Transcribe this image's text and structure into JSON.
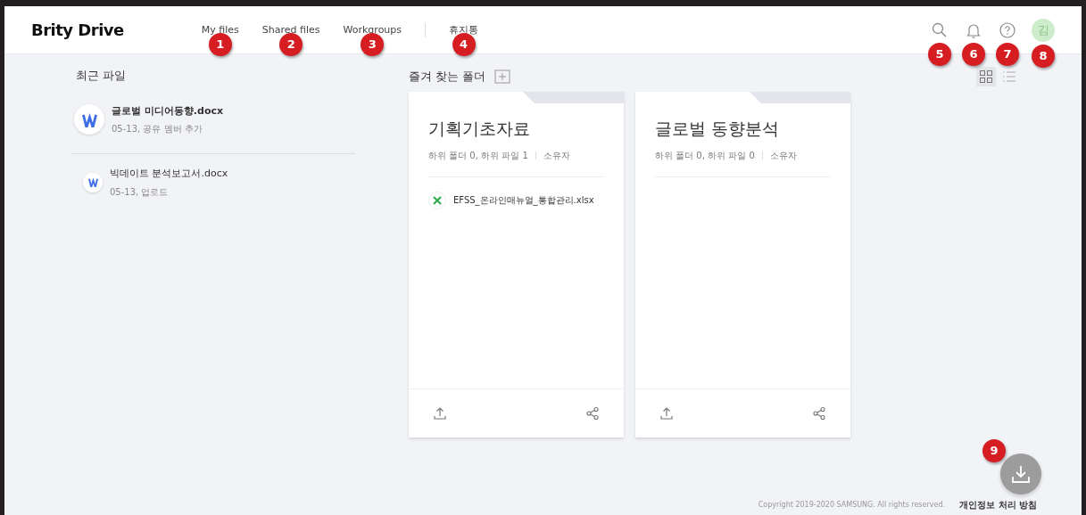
{
  "header": {
    "logo": "Brity Drive",
    "nav": [
      {
        "label": "My files",
        "callout": "1"
      },
      {
        "label": "Shared files",
        "callout": "2"
      },
      {
        "label": "Workgroups",
        "callout": "3"
      },
      {
        "label": "휴지통",
        "callout": "4"
      }
    ],
    "actions": [
      {
        "kind": "search",
        "callout": "5"
      },
      {
        "kind": "bell",
        "callout": "6"
      },
      {
        "kind": "help",
        "callout": "7"
      },
      {
        "kind": "avatar",
        "label": "김",
        "callout": "8"
      }
    ]
  },
  "recent": {
    "title": "최근 파일",
    "files": [
      {
        "name": "글로벌 미디어동향.docx",
        "meta": "05-13, 공유 멤버 추가",
        "featured": true
      },
      {
        "name": "빅데이트 분석보고서.docx",
        "meta": "05-13, 업로드",
        "featured": false
      }
    ]
  },
  "favorites": {
    "title": "즐겨 찾는 폴더",
    "view_buttons": [
      {
        "kind": "grid",
        "selected": true
      },
      {
        "kind": "list",
        "selected": false
      }
    ],
    "folders": [
      {
        "title": "기획기초자료",
        "meta": "하위 폴더 0, 하위 파일 1",
        "owner": "소유자",
        "files": [
          {
            "name": "EFSS_온라인매뉴얼_통합관리.xlsx"
          }
        ]
      },
      {
        "title": "글로벌 동향분석",
        "meta": "하위 폴더 0, 하위 파일 0",
        "owner": "소유자"
      }
    ]
  },
  "download": {
    "callout": "9"
  },
  "footer": {
    "copyright": "Copyright 2019-2020 SAMSUNG. All rights reserved.",
    "link": "개인정보 처리 방침"
  }
}
